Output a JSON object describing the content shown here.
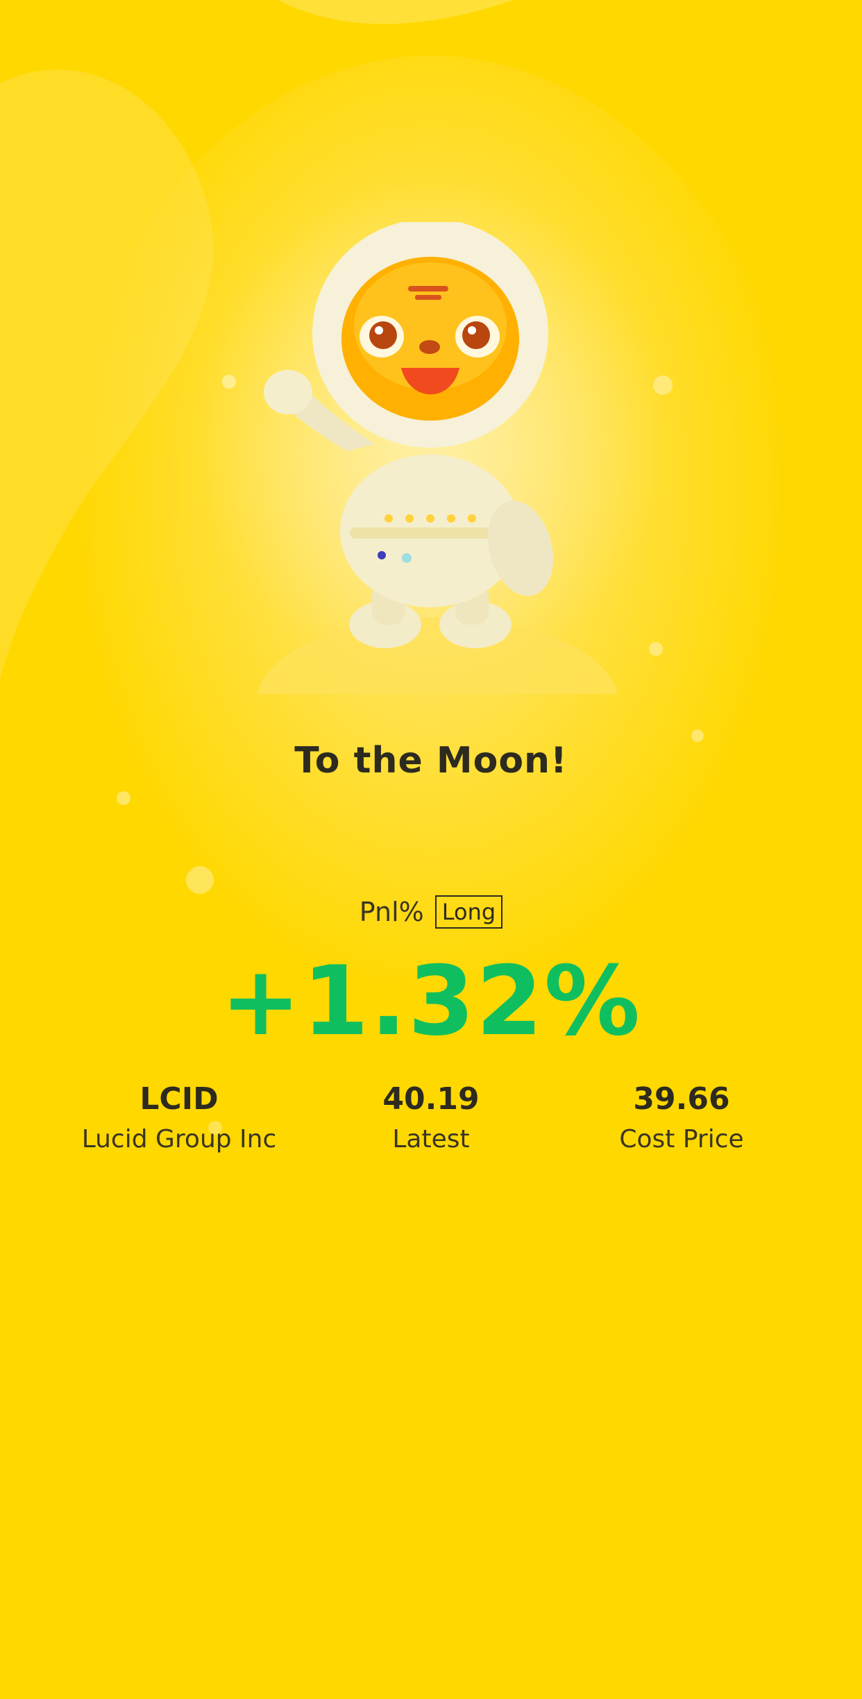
{
  "title": "To the Moon!",
  "pnl": {
    "label": "Pnl%",
    "direction_tag": "Long",
    "value": "+1.32%",
    "value_color": "#0fbf5f"
  },
  "stats": [
    {
      "value": "LCID",
      "label": "Lucid Group Inc"
    },
    {
      "value": "40.19",
      "label": "Latest"
    },
    {
      "value": "39.66",
      "label": "Cost Price"
    }
  ],
  "colors": {
    "background": "#ffd800",
    "text": "#2d2a1f"
  },
  "mascot": {
    "icon": "astronaut-tiger-mascot"
  }
}
